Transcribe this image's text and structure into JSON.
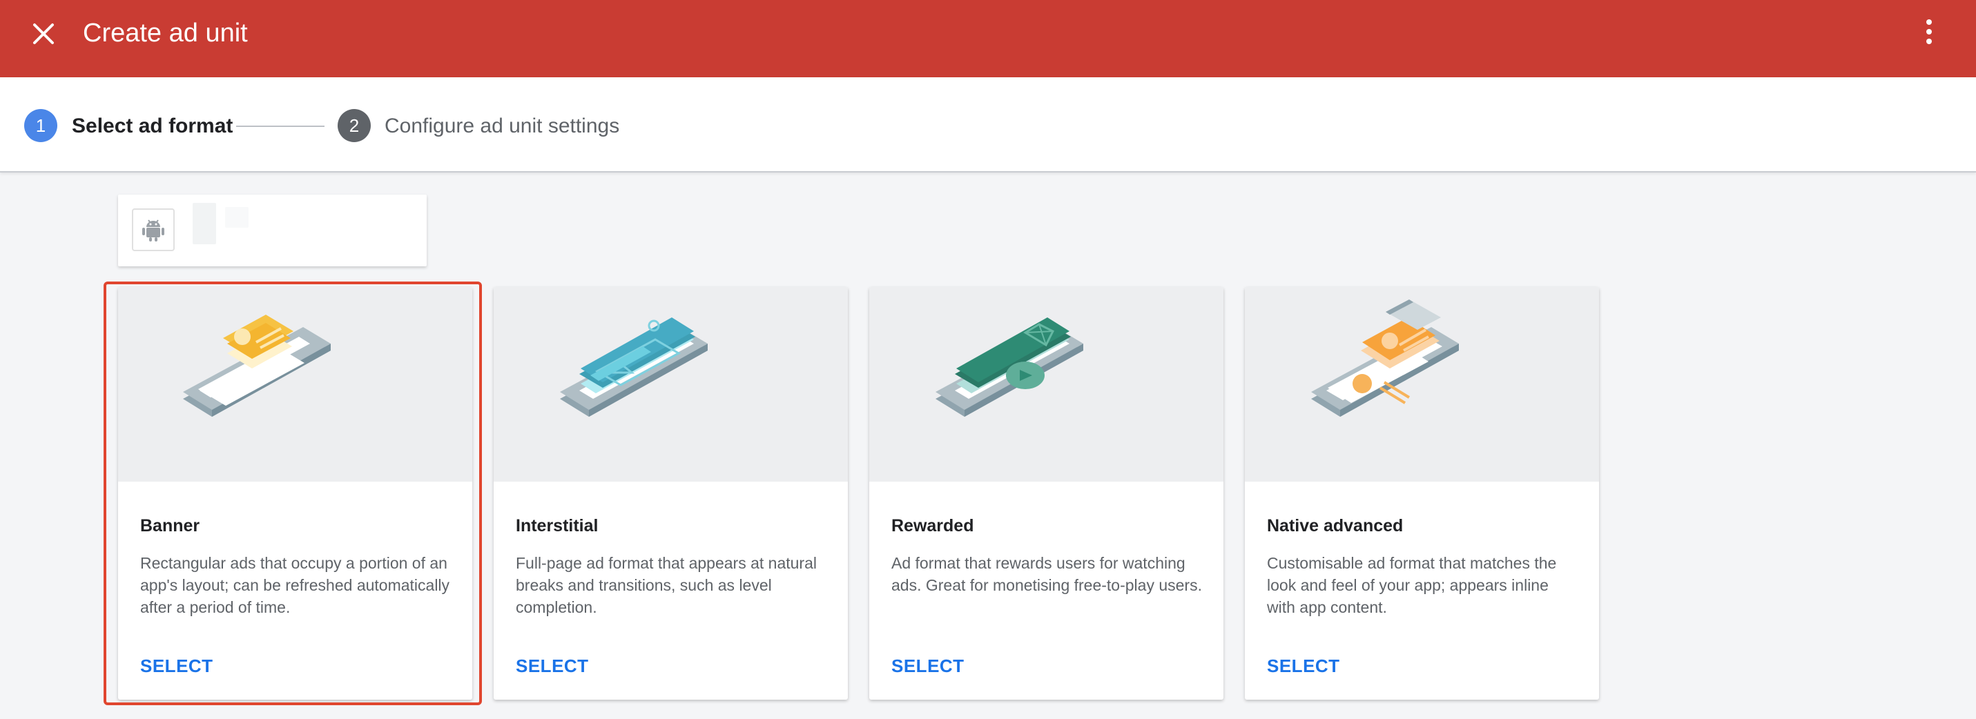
{
  "appbar": {
    "title": "Create ad unit",
    "close_icon": "close-icon",
    "more_icon": "more-vert-icon",
    "color": "#c93c33"
  },
  "stepper": {
    "steps": [
      {
        "number": "1",
        "label": "Select ad format",
        "state": "active",
        "color": "#4a86e8"
      },
      {
        "number": "2",
        "label": "Configure ad unit settings",
        "state": "inactive",
        "color": "#5f6368"
      }
    ]
  },
  "app_selector": {
    "platform_icon": "android-icon"
  },
  "formats": [
    {
      "name": "Banner",
      "description": "Rectangular ads that occupy a portion of an app's layout; can be refreshed automatically after a period of time.",
      "action": "SELECT",
      "highlighted": true
    },
    {
      "name": "Interstitial",
      "description": "Full-page ad format that appears at natural breaks and transitions, such as level completion.",
      "action": "SELECT",
      "highlighted": false
    },
    {
      "name": "Rewarded",
      "description": "Ad format that rewards users for watching ads. Great for monetising free-to-play users.",
      "action": "SELECT",
      "highlighted": false
    },
    {
      "name": "Native advanced",
      "description": "Customisable ad format that matches the look and feel of your app; appears inline with app content.",
      "action": "SELECT",
      "highlighted": false
    }
  ],
  "colors": {
    "select": "#1a73e8",
    "highlight_border": "#e0462f"
  }
}
